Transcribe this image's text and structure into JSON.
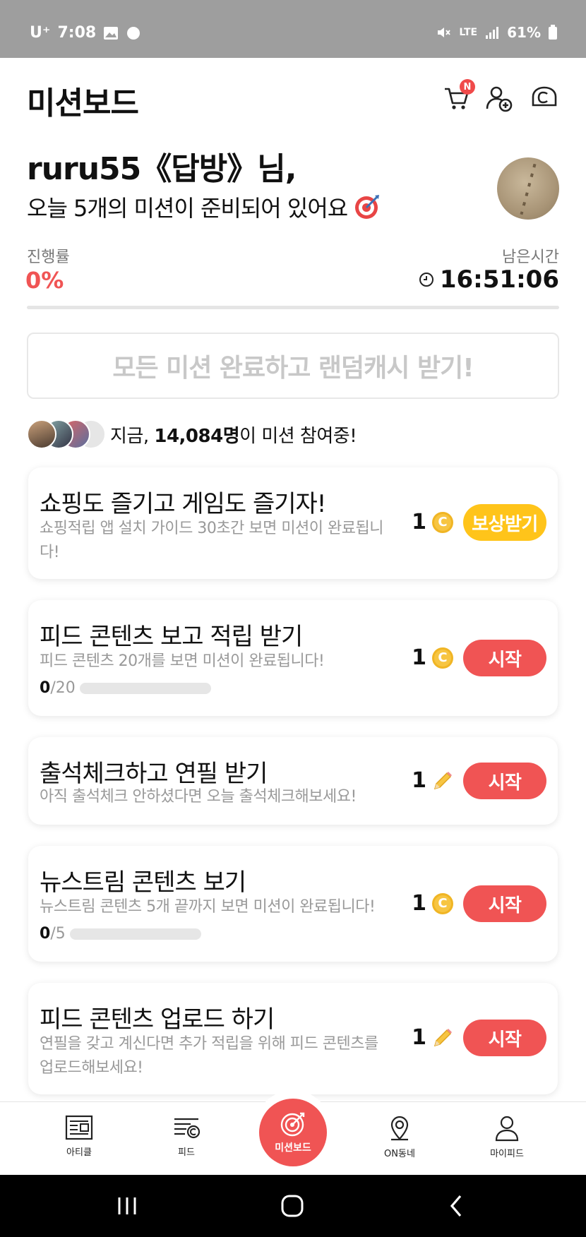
{
  "status_bar": {
    "carrier": "U⁺",
    "time": "7:08",
    "network": "LTE",
    "battery": "61%"
  },
  "header": {
    "title": "미션보드",
    "cart_badge": "N"
  },
  "greeting": {
    "name": "ruru55《답방》님,",
    "subtitle": "오늘 5개의 미션이 준비되어 있어요"
  },
  "progress": {
    "label": "진행률",
    "value": "0%",
    "fraction": 0
  },
  "remaining": {
    "label": "남은시간",
    "value": "16:51:06"
  },
  "banner": {
    "text": "모든 미션 완료하고 랜덤캐시 받기!"
  },
  "participants": {
    "prefix": "지금, ",
    "count": "14,084명",
    "suffix": "이 미션 참여중!"
  },
  "missions": [
    {
      "title": "쇼핑도 즐기고 게임도 즐기자!",
      "desc": "쇼핑적립 앱 설치 가이드 30초간 보면 미션이 완료됩니다!",
      "reward_amount": "1",
      "reward_icon": "coin-icon",
      "button": "보상받기"
    },
    {
      "title": "피드 콘텐츠 보고 적립 받기",
      "desc": "피드 콘텐츠 20개를 보면 미션이 완료됩니다!",
      "progress_done": "0",
      "progress_total": "/20",
      "reward_amount": "1",
      "reward_icon": "coin-icon",
      "button": "시작"
    },
    {
      "title": "출석체크하고 연필 받기",
      "desc": "아직 출석체크 안하셨다면 오늘 출석체크해보세요!",
      "reward_amount": "1",
      "reward_icon": "pencil-icon",
      "button": "시작"
    },
    {
      "title": "뉴스트림 콘텐츠 보기",
      "desc": "뉴스트림 콘텐츠 5개 끝까지 보면 미션이 완료됩니다!",
      "progress_done": "0",
      "progress_total": "/5",
      "reward_amount": "1",
      "reward_icon": "coin-icon",
      "button": "시작"
    },
    {
      "title": "피드 콘텐츠 업로드 하기",
      "desc": "연필을 갖고 계신다면 추가 적립을 위해 피드 콘텐츠를 업로드해보세요!",
      "reward_amount": "1",
      "reward_icon": "pencil-icon",
      "button": "시작"
    }
  ],
  "bottom_nav": {
    "article": "아티클",
    "feed": "피드",
    "missionboard": "미션보드",
    "on_neighborhood": "ON동네",
    "my_feed": "마이피드"
  },
  "colors": {
    "accent": "#f05454",
    "reward_button": "#ffc41a",
    "coin": "#f7c542"
  }
}
